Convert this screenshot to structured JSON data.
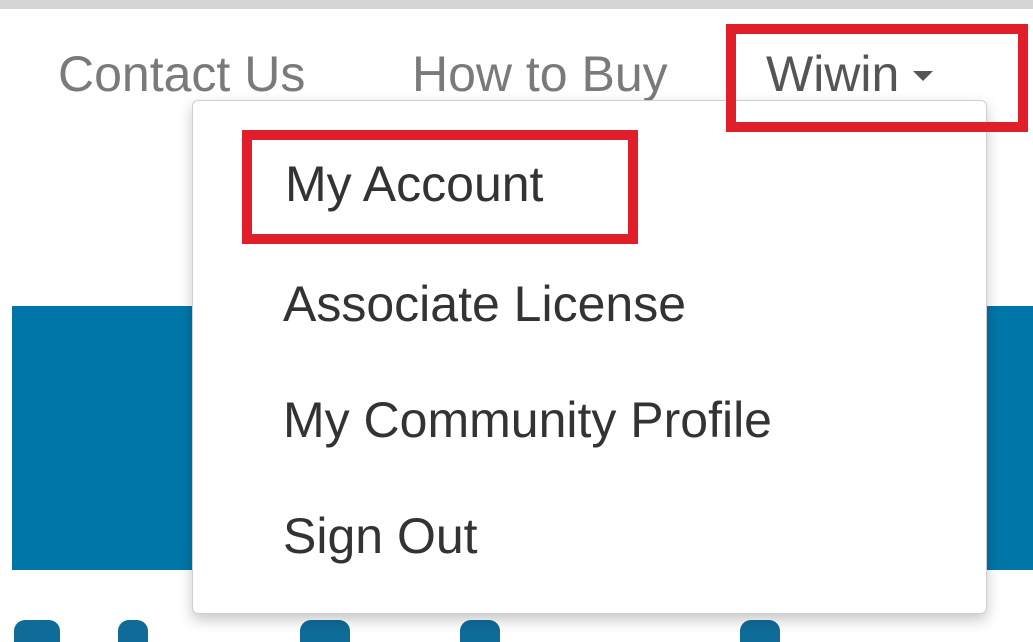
{
  "nav": {
    "contact_label": "Contact Us",
    "how_to_buy_label": "How to Buy",
    "user_label": "Wiwin",
    "user_caret_icon": "caret-down-icon"
  },
  "user_menu": {
    "items": [
      {
        "label": "My Account"
      },
      {
        "label": "Associate License"
      },
      {
        "label": "My Community Profile"
      },
      {
        "label": "Sign Out"
      }
    ]
  },
  "colors": {
    "banner": "#0076a8",
    "highlight": "#e01f2a",
    "nav_text": "#7a7a7a",
    "menu_text": "#333333"
  }
}
